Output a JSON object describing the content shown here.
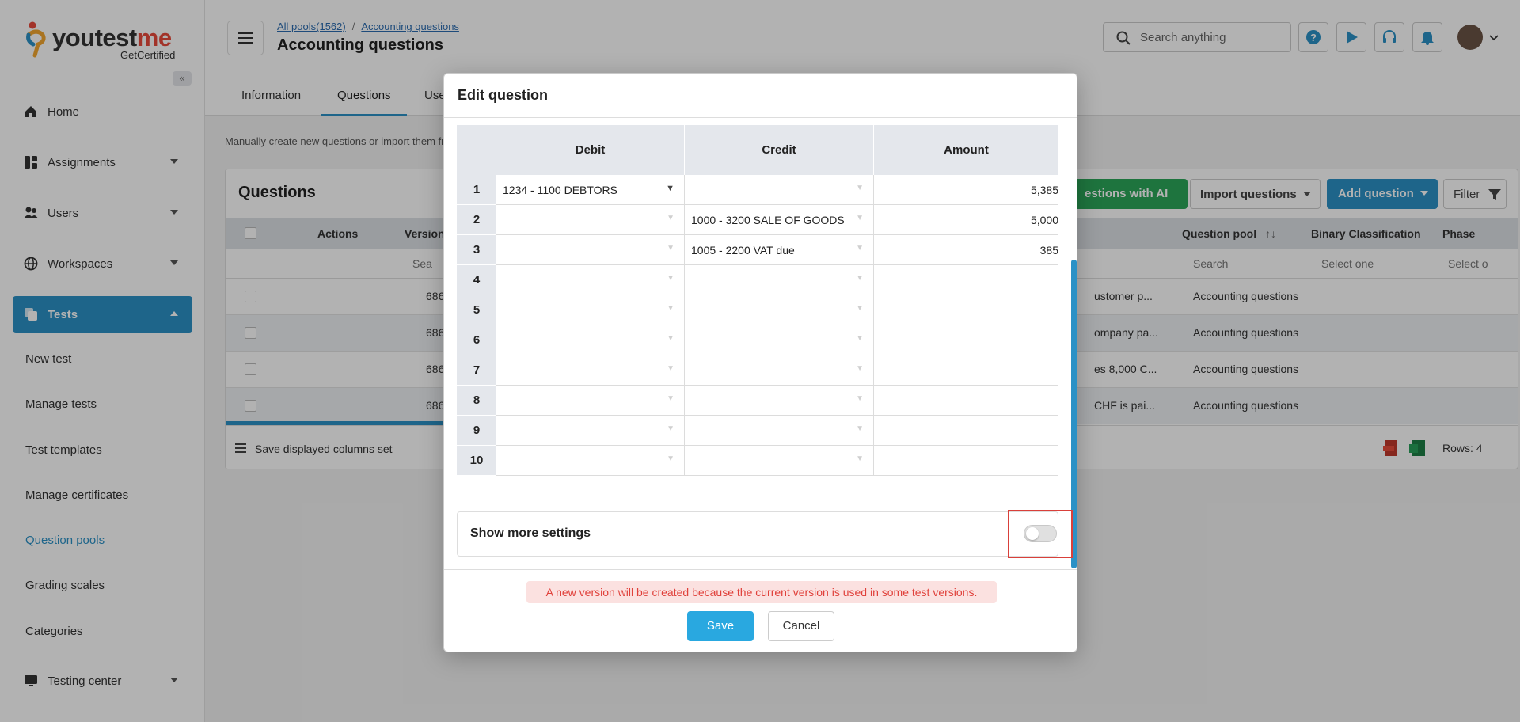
{
  "brand": {
    "name_part1": "youtest",
    "name_part2": "me",
    "sub": "GetCertified"
  },
  "sidebar": {
    "collapse_label": "«",
    "items": [
      {
        "label": "Home",
        "icon": "home-icon"
      },
      {
        "label": "Assignments",
        "icon": "assignments-icon"
      },
      {
        "label": "Users",
        "icon": "users-icon"
      },
      {
        "label": "Workspaces",
        "icon": "globe-icon"
      },
      {
        "label": "Tests",
        "icon": "tests-icon"
      }
    ],
    "sub_items": [
      "New test",
      "Manage tests",
      "Test templates",
      "Manage certificates",
      "Question pools",
      "Grading scales",
      "Categories"
    ],
    "testing_center": "Testing center"
  },
  "header": {
    "crumb_all": "All pools(1562)",
    "crumb_sep": "/",
    "crumb_current": "Accounting questions",
    "title": "Accounting questions",
    "search_placeholder": "Search anything"
  },
  "tabs": [
    "Information",
    "Questions",
    "Use"
  ],
  "hint": "Manually create new questions or import them fr",
  "questions_card": {
    "title": "Questions",
    "ai_button": "estions with AI",
    "import_button": "Import questions",
    "add_button": "Add question",
    "filter_button": "Filter",
    "col_actions": "Actions",
    "col_version": "Version",
    "col_pool": "Question pool",
    "col_sort": "↑↓",
    "col_binary": "Binary Classification",
    "col_phase": "Phase",
    "filter_search": "Sea",
    "filter_pool": "Search",
    "filter_binary": "Select one",
    "filter_phase": "Select o",
    "rows": [
      {
        "version": "686",
        "text": "ustomer p...",
        "pool": "Accounting questions"
      },
      {
        "version": "686",
        "text": "ompany pa...",
        "pool": "Accounting questions"
      },
      {
        "version": "686",
        "text": "es 8,000 C...",
        "pool": "Accounting questions"
      },
      {
        "version": "686",
        "text": "CHF is pai...",
        "pool": "Accounting questions"
      }
    ],
    "save_columns": "Save displayed columns set",
    "rows_count": "Rows: 4"
  },
  "modal": {
    "title": "Edit question",
    "col_debit": "Debit",
    "col_credit": "Credit",
    "col_amount": "Amount",
    "rows": [
      {
        "n": "1",
        "debit": "1234 - 1100 DEBTORS",
        "credit": "",
        "amount": "5,385"
      },
      {
        "n": "2",
        "debit": "",
        "credit": "1000 - 3200 SALE OF GOODS",
        "amount": "5,000"
      },
      {
        "n": "3",
        "debit": "",
        "credit": "1005 - 2200 VAT due",
        "amount": "385"
      },
      {
        "n": "4",
        "debit": "",
        "credit": "",
        "amount": ""
      },
      {
        "n": "5",
        "debit": "",
        "credit": "",
        "amount": ""
      },
      {
        "n": "6",
        "debit": "",
        "credit": "",
        "amount": ""
      },
      {
        "n": "7",
        "debit": "",
        "credit": "",
        "amount": ""
      },
      {
        "n": "8",
        "debit": "",
        "credit": "",
        "amount": ""
      },
      {
        "n": "9",
        "debit": "",
        "credit": "",
        "amount": ""
      },
      {
        "n": "10",
        "debit": "",
        "credit": "",
        "amount": ""
      }
    ],
    "show_more_settings": "Show more settings",
    "show_more_enabled": false,
    "warning": "A new version will be created because the current version is used in some test versions.",
    "save": "Save",
    "cancel": "Cancel"
  },
  "colors": {
    "accent": "#2b91c6",
    "green": "#2ca65a",
    "warning_text": "#e0413b",
    "highlight": "#d9403a"
  }
}
